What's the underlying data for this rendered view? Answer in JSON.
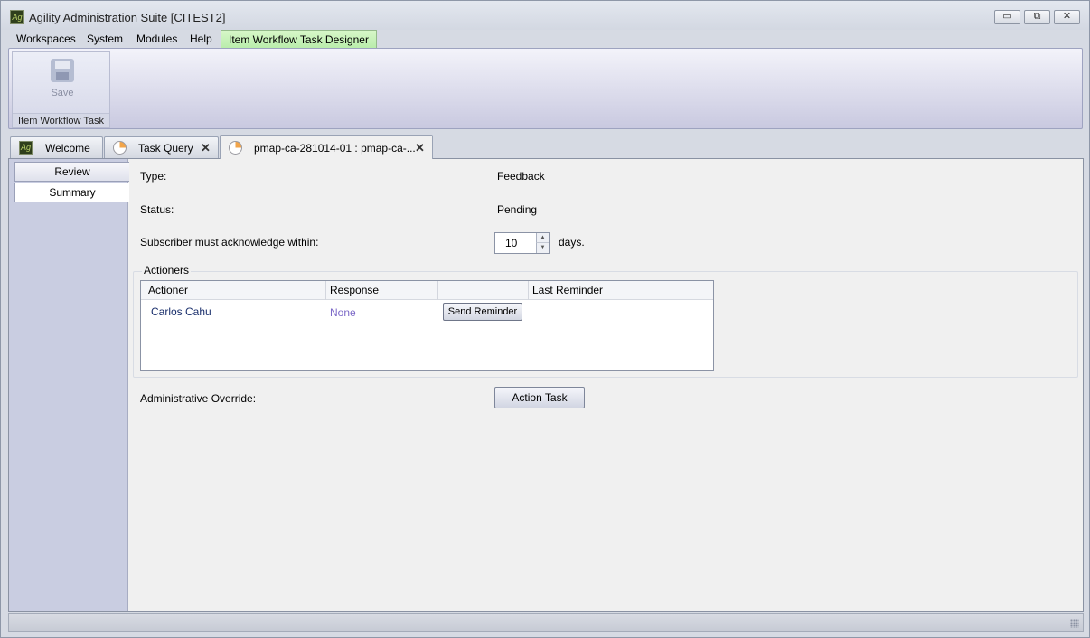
{
  "window": {
    "title": "Agility Administration Suite [CITEST2]",
    "logo_text": "Ag",
    "minimize_glyph": "▭",
    "restore_glyph": "⧉",
    "close_glyph": "✕"
  },
  "menu": {
    "items": [
      "Workspaces",
      "System",
      "Modules",
      "Help"
    ],
    "context_tab": "Item Workflow Task Designer"
  },
  "ribbon": {
    "save_label": "Save",
    "save_enabled": false,
    "group_label": "Item Workflow Task"
  },
  "tabs": [
    {
      "label": "Welcome",
      "icon": "agility-logo-icon",
      "closable": false
    },
    {
      "label": "Task Query",
      "icon": "task-clock-icon",
      "closable": true
    },
    {
      "label": "pmap-ca-281014-01 : pmap-ca-...",
      "icon": "task-clock-icon",
      "closable": true,
      "active": true
    }
  ],
  "tab_close_glyph": "✕",
  "side_nav": {
    "items": [
      "Review",
      "Summary"
    ],
    "selected": "Summary"
  },
  "form": {
    "type_label": "Type:",
    "type_value": "Feedback",
    "status_label": "Status:",
    "status_value": "Pending",
    "ack_label": "Subscriber must acknowledge within:",
    "ack_value": "10",
    "ack_unit": "days.",
    "override_label": "Administrative Override:",
    "action_button": "Action Task"
  },
  "actioners": {
    "group_title": "Actioners",
    "columns": [
      "Actioner",
      "Response",
      "",
      "Last Reminder"
    ],
    "rows": [
      {
        "actioner": "Carlos Cahu",
        "response": "None",
        "button": "Send Reminder",
        "last_reminder": ""
      }
    ]
  },
  "colors": {
    "context_tab": "#c4f0b8",
    "actioner_link": "#1a2f6c",
    "response_text": "#7b68c7"
  }
}
